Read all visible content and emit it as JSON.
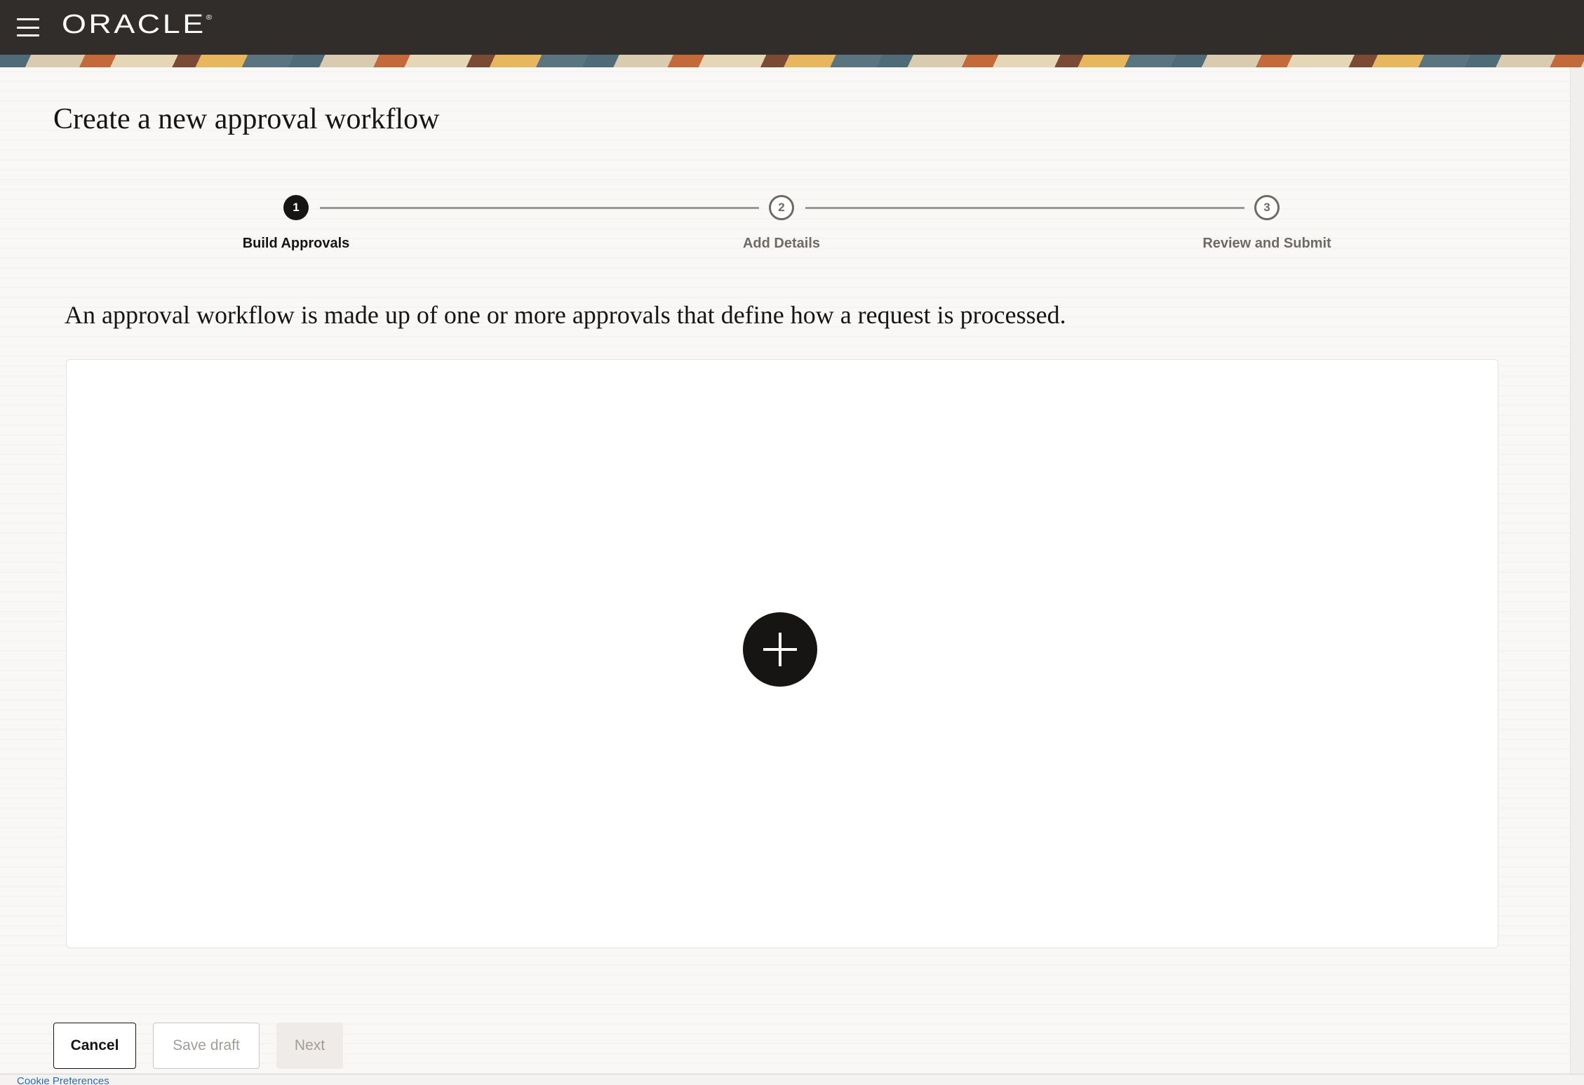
{
  "header": {
    "logo_text": "ORACLE",
    "logo_mark": "®",
    "menu_icon": "hamburger-icon"
  },
  "page": {
    "title": "Create a new approval workflow",
    "intro": "An approval workflow is made up of one or more approvals that define how a request is processed."
  },
  "stepper": {
    "steps": [
      {
        "number": "1",
        "label": "Build Approvals",
        "state": "active"
      },
      {
        "number": "2",
        "label": "Add Details",
        "state": "inactive"
      },
      {
        "number": "3",
        "label": "Review and Submit",
        "state": "inactive"
      }
    ]
  },
  "canvas": {
    "add_icon": "plus-icon"
  },
  "footer": {
    "cancel_label": "Cancel",
    "save_draft_label": "Save draft",
    "next_label": "Next",
    "bottom_link": "Cookie Preferences"
  },
  "colors": {
    "header_bg": "#312d2a",
    "text": "#161513",
    "muted": "#6f6964",
    "disabled": "#a29c97"
  }
}
